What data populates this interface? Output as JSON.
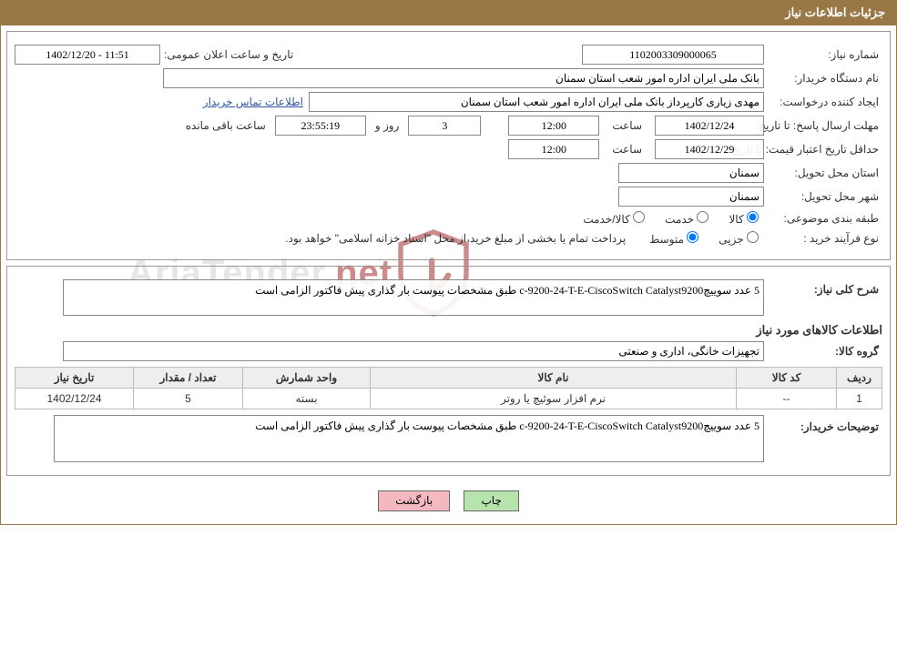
{
  "header": {
    "title": "جزئیات اطلاعات نیاز"
  },
  "watermark": {
    "text_a": "AriaTender",
    "text_b": ".net"
  },
  "fields": {
    "need_number_label": "شماره نیاز:",
    "need_number": "1102003309000065",
    "announce_label": "تاریخ و ساعت اعلان عمومی:",
    "announce_value": "1402/12/20 - 11:51",
    "buyer_org_label": "نام دستگاه خریدار:",
    "buyer_org": "بانک ملی ایران اداره امور شعب استان سمنان",
    "requester_label": "ایجاد کننده درخواست:",
    "requester": "مهدی زیاری کارپرداز بانک ملی ایران اداره امور شعب استان سمنان",
    "contact_link": "اطلاعات تماس خریدار",
    "reply_deadline_label": "مهلت ارسال پاسخ:",
    "to_date_label": "تا تاریخ:",
    "reply_date": "1402/12/24",
    "time_label": "ساعت",
    "reply_time": "12:00",
    "days": "3",
    "days_label": "روز و",
    "countdown": "23:55:19",
    "time_remaining_label": "ساعت باقی مانده",
    "price_validity_label": "حداقل تاریخ اعتبار قیمت:",
    "price_date": "1402/12/29",
    "price_time": "12:00",
    "delivery_province_label": "استان محل تحویل:",
    "delivery_province": "سمنان",
    "delivery_city_label": "شهر محل تحویل:",
    "delivery_city": "سمنان",
    "category_label": "طبقه بندی موضوعی:",
    "cat_goods": "کالا",
    "cat_service": "خدمت",
    "cat_goods_service": "کالا/خدمت",
    "purchase_type_label": "نوع فرآیند خرید :",
    "pt_minor": "جزیی",
    "pt_medium": "متوسط",
    "purchase_note": "پرداخت تمام یا بخشی از مبلغ خرید،از محل \"اسناد خزانه اسلامی\" خواهد بود."
  },
  "detail": {
    "desc_label": "شرح کلی نیاز:",
    "desc_value": "5 عدد سوییچc-9200-24-T-E-CiscoSwitch Catalyst9200 طبق مشخصات پیوست بار گذاری پیش فاکتور الزامی است",
    "items_title": "اطلاعات کالاهای مورد نیاز",
    "group_label": "گروه کالا:",
    "group_value": "تجهیزات خانگی، اداری و صنعتی",
    "buyer_note_label": "توضیحات خریدار:",
    "buyer_note_value": "5 عدد سوییچc-9200-24-T-E-CiscoSwitch Catalyst9200 طبق مشخصات پیوست بار گذاری پیش فاکتور الزامی است"
  },
  "table": {
    "headers": {
      "row": "ردیف",
      "code": "کد کالا",
      "name": "نام کالا",
      "unit": "واحد شمارش",
      "qty": "تعداد / مقدار",
      "date": "تاریخ نیاز"
    },
    "rows": [
      {
        "row": "1",
        "code": "--",
        "name": "نرم افزار سوئیچ یا روتر",
        "unit": "بسته",
        "qty": "5",
        "date": "1402/12/24"
      }
    ]
  },
  "buttons": {
    "print": "چاپ",
    "back": "بازگشت"
  }
}
